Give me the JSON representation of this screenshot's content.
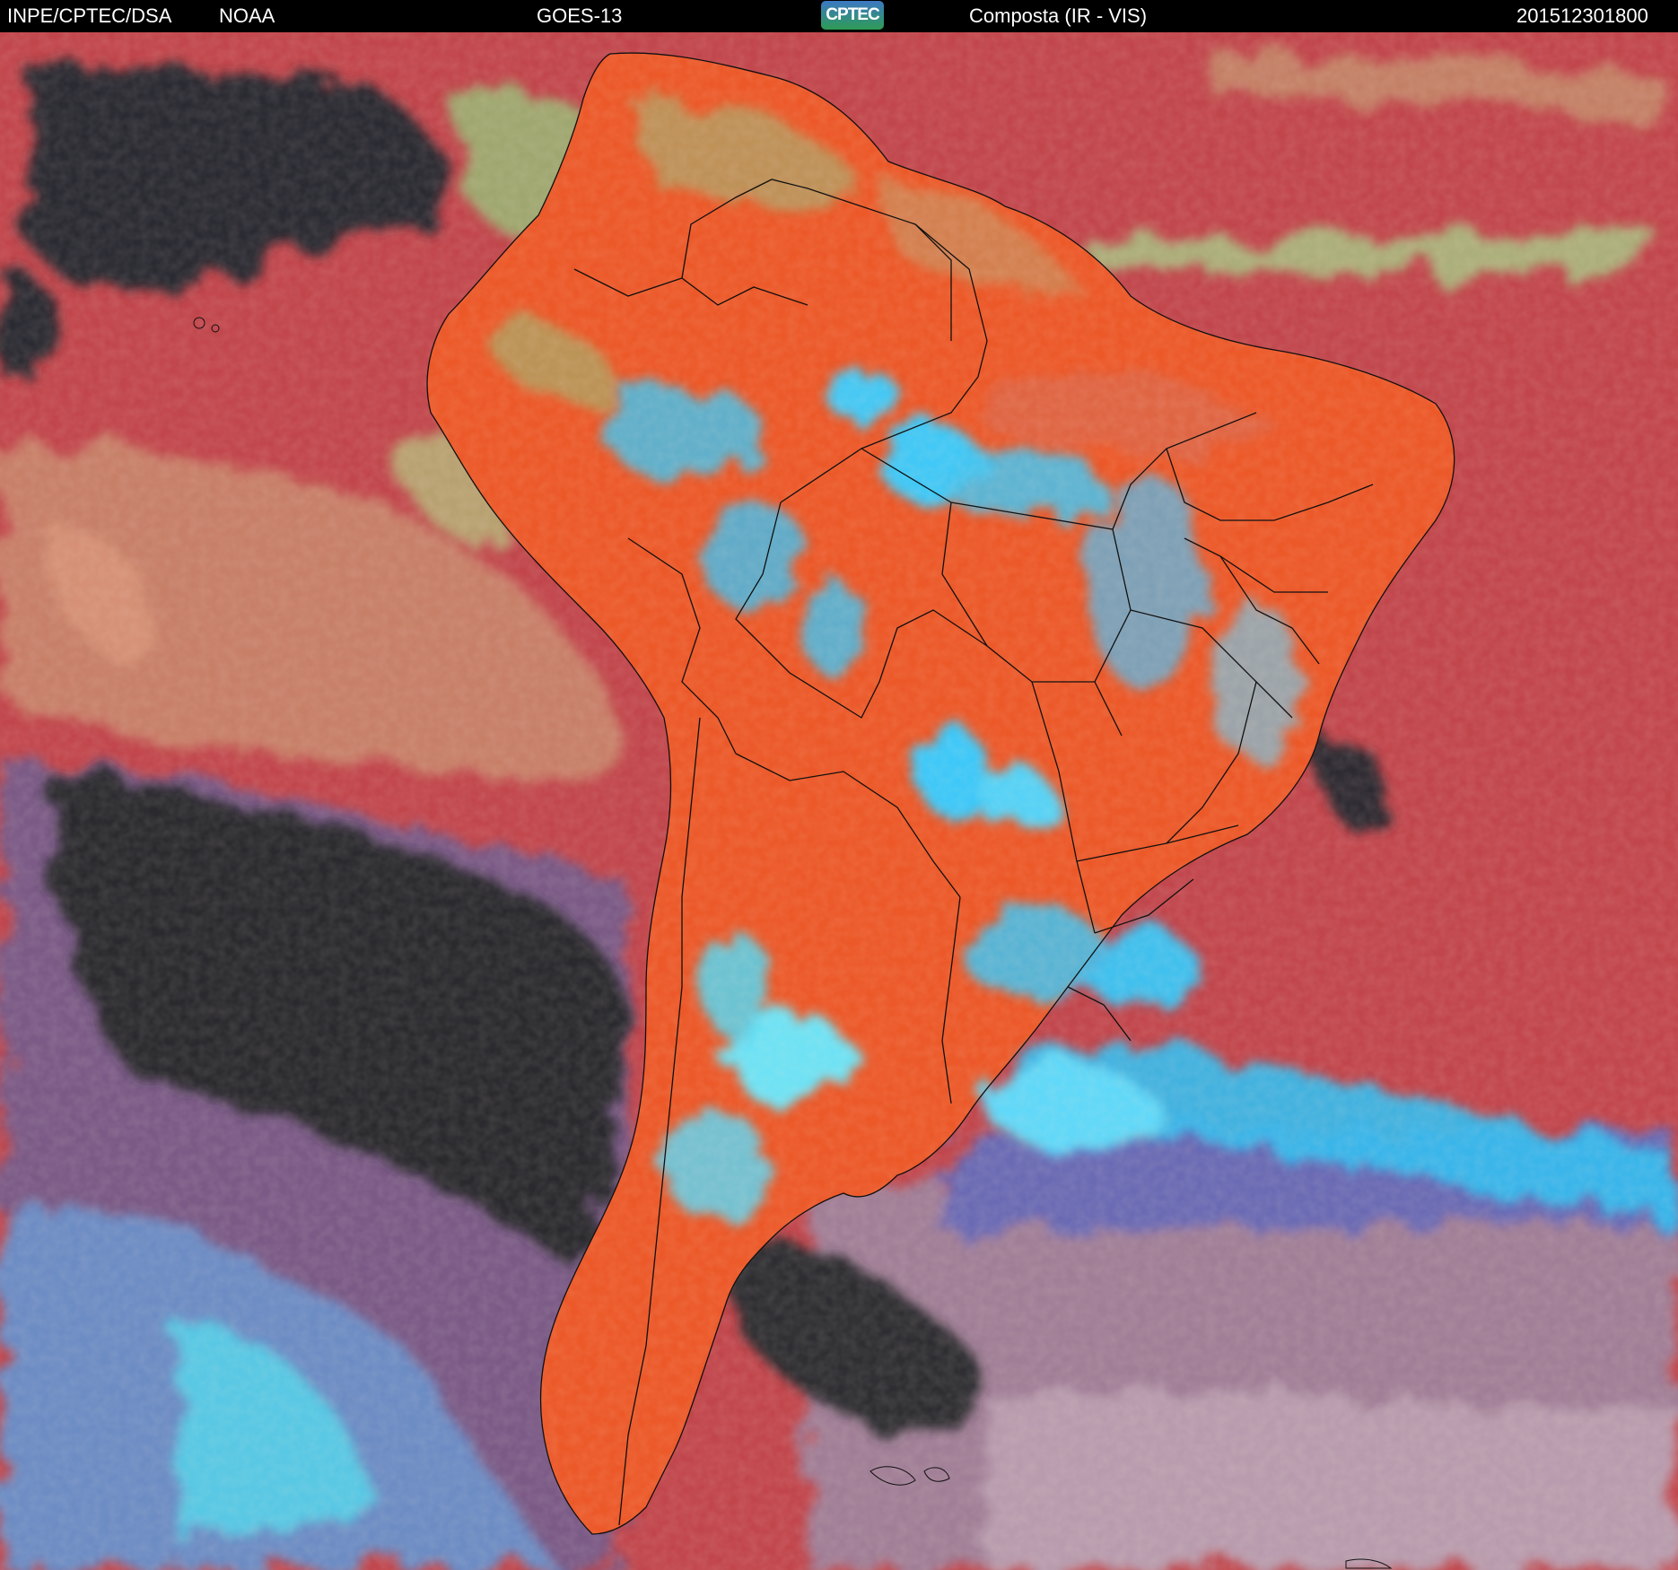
{
  "header": {
    "source": "INPE/CPTEC/DSA",
    "agency": "NOAA",
    "satellite": "GOES-13",
    "logo_text": "CPTEC",
    "product": "Composta (IR - VIS)",
    "timestamp": "201512301800"
  },
  "colors": {
    "header_bg": "#000000",
    "header_text": "#ffffff",
    "ocean_warm": "#c2444a",
    "land_warm": "#ee5424",
    "clear_cold_sea": "#2a2a30",
    "high_cloud": "#3ec8f4",
    "mid_cloud": "#8ed07e",
    "low_cloud": "#b8a86e",
    "mixed_cloud": "#8a5aa8",
    "borders": "#101010"
  }
}
